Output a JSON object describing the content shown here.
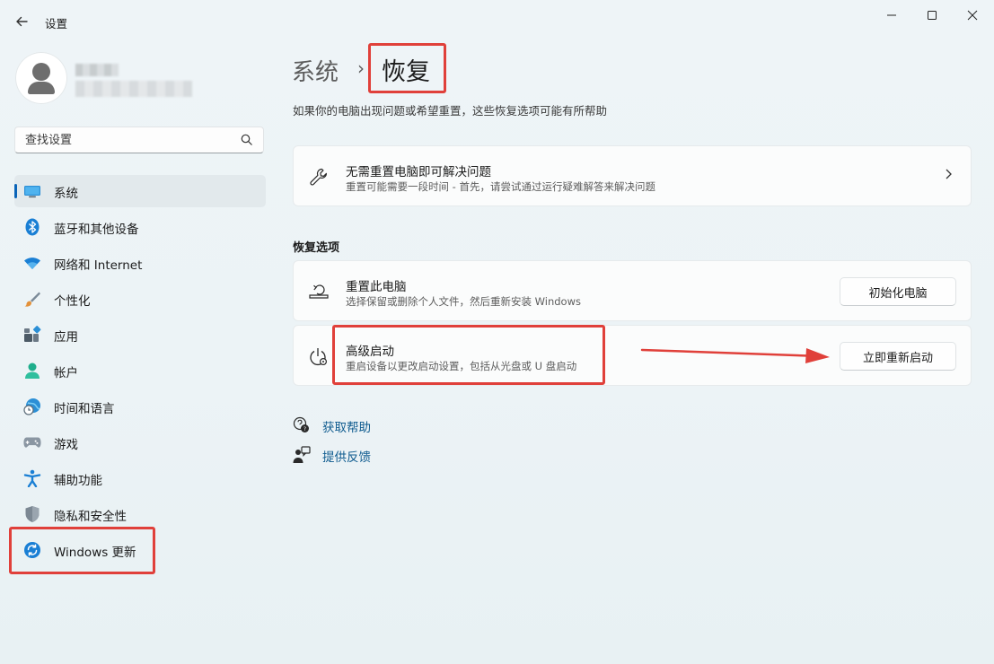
{
  "window": {
    "title": "设置",
    "controls": [
      "minimize-icon",
      "maximize-icon",
      "close-icon"
    ]
  },
  "search": {
    "placeholder": "查找设置"
  },
  "sidebar": {
    "items": [
      {
        "label": "系统",
        "icon": "monitor-icon",
        "selected": true
      },
      {
        "label": "蓝牙和其他设备",
        "icon": "bluetooth-icon"
      },
      {
        "label": "网络和 Internet",
        "icon": "wifi-icon"
      },
      {
        "label": "个性化",
        "icon": "brush-icon"
      },
      {
        "label": "应用",
        "icon": "apps-icon"
      },
      {
        "label": "帐户",
        "icon": "account-icon"
      },
      {
        "label": "时间和语言",
        "icon": "globe-clock-icon"
      },
      {
        "label": "游戏",
        "icon": "gamepad-icon"
      },
      {
        "label": "辅助功能",
        "icon": "accessibility-icon"
      },
      {
        "label": "隐私和安全性",
        "icon": "shield-icon"
      },
      {
        "label": "Windows 更新",
        "icon": "update-icon"
      }
    ]
  },
  "breadcrumb": {
    "parent": "系统",
    "separator": "›",
    "current": "恢复"
  },
  "page": {
    "description": "如果你的电脑出现问题或希望重置，这些恢复选项可能有所帮助"
  },
  "troubleshoot_card": {
    "title": "无需重置电脑即可解决问题",
    "subtitle": "重置可能需要一段时间 - 首先，请尝试通过运行疑难解答来解决问题"
  },
  "recovery_options": {
    "heading": "恢复选项",
    "reset": {
      "title": "重置此电脑",
      "subtitle": "选择保留或删除个人文件，然后重新安装 Windows",
      "button": "初始化电脑"
    },
    "advanced": {
      "title": "高级启动",
      "subtitle": "重启设备以更改启动设置，包括从光盘或 U 盘启动",
      "button": "立即重新启动"
    }
  },
  "links": {
    "help": "获取帮助",
    "feedback": "提供反馈"
  },
  "colors": {
    "accent": "#0a64b8",
    "annotation": "#e0403a"
  }
}
